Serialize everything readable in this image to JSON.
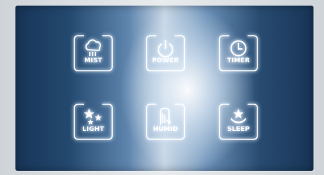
{
  "panel": {
    "buttons": [
      {
        "id": "mist",
        "label": "MIST",
        "icon": "cloud-mist-icon"
      },
      {
        "id": "power",
        "label": "POWER",
        "icon": "power-icon"
      },
      {
        "id": "timer",
        "label": "TIMER",
        "icon": "clock-icon"
      },
      {
        "id": "light",
        "label": "LIGHT",
        "icon": "stars-icon"
      },
      {
        "id": "humid",
        "label": "HUMID",
        "icon": "humidity-gauge-icon"
      },
      {
        "id": "sleep",
        "label": "SLEEP",
        "icon": "star-moon-icon"
      }
    ]
  },
  "colors": {
    "glow": "#ffffff",
    "panel_edge": "#173457",
    "panel_center": "#c8d7e6"
  }
}
